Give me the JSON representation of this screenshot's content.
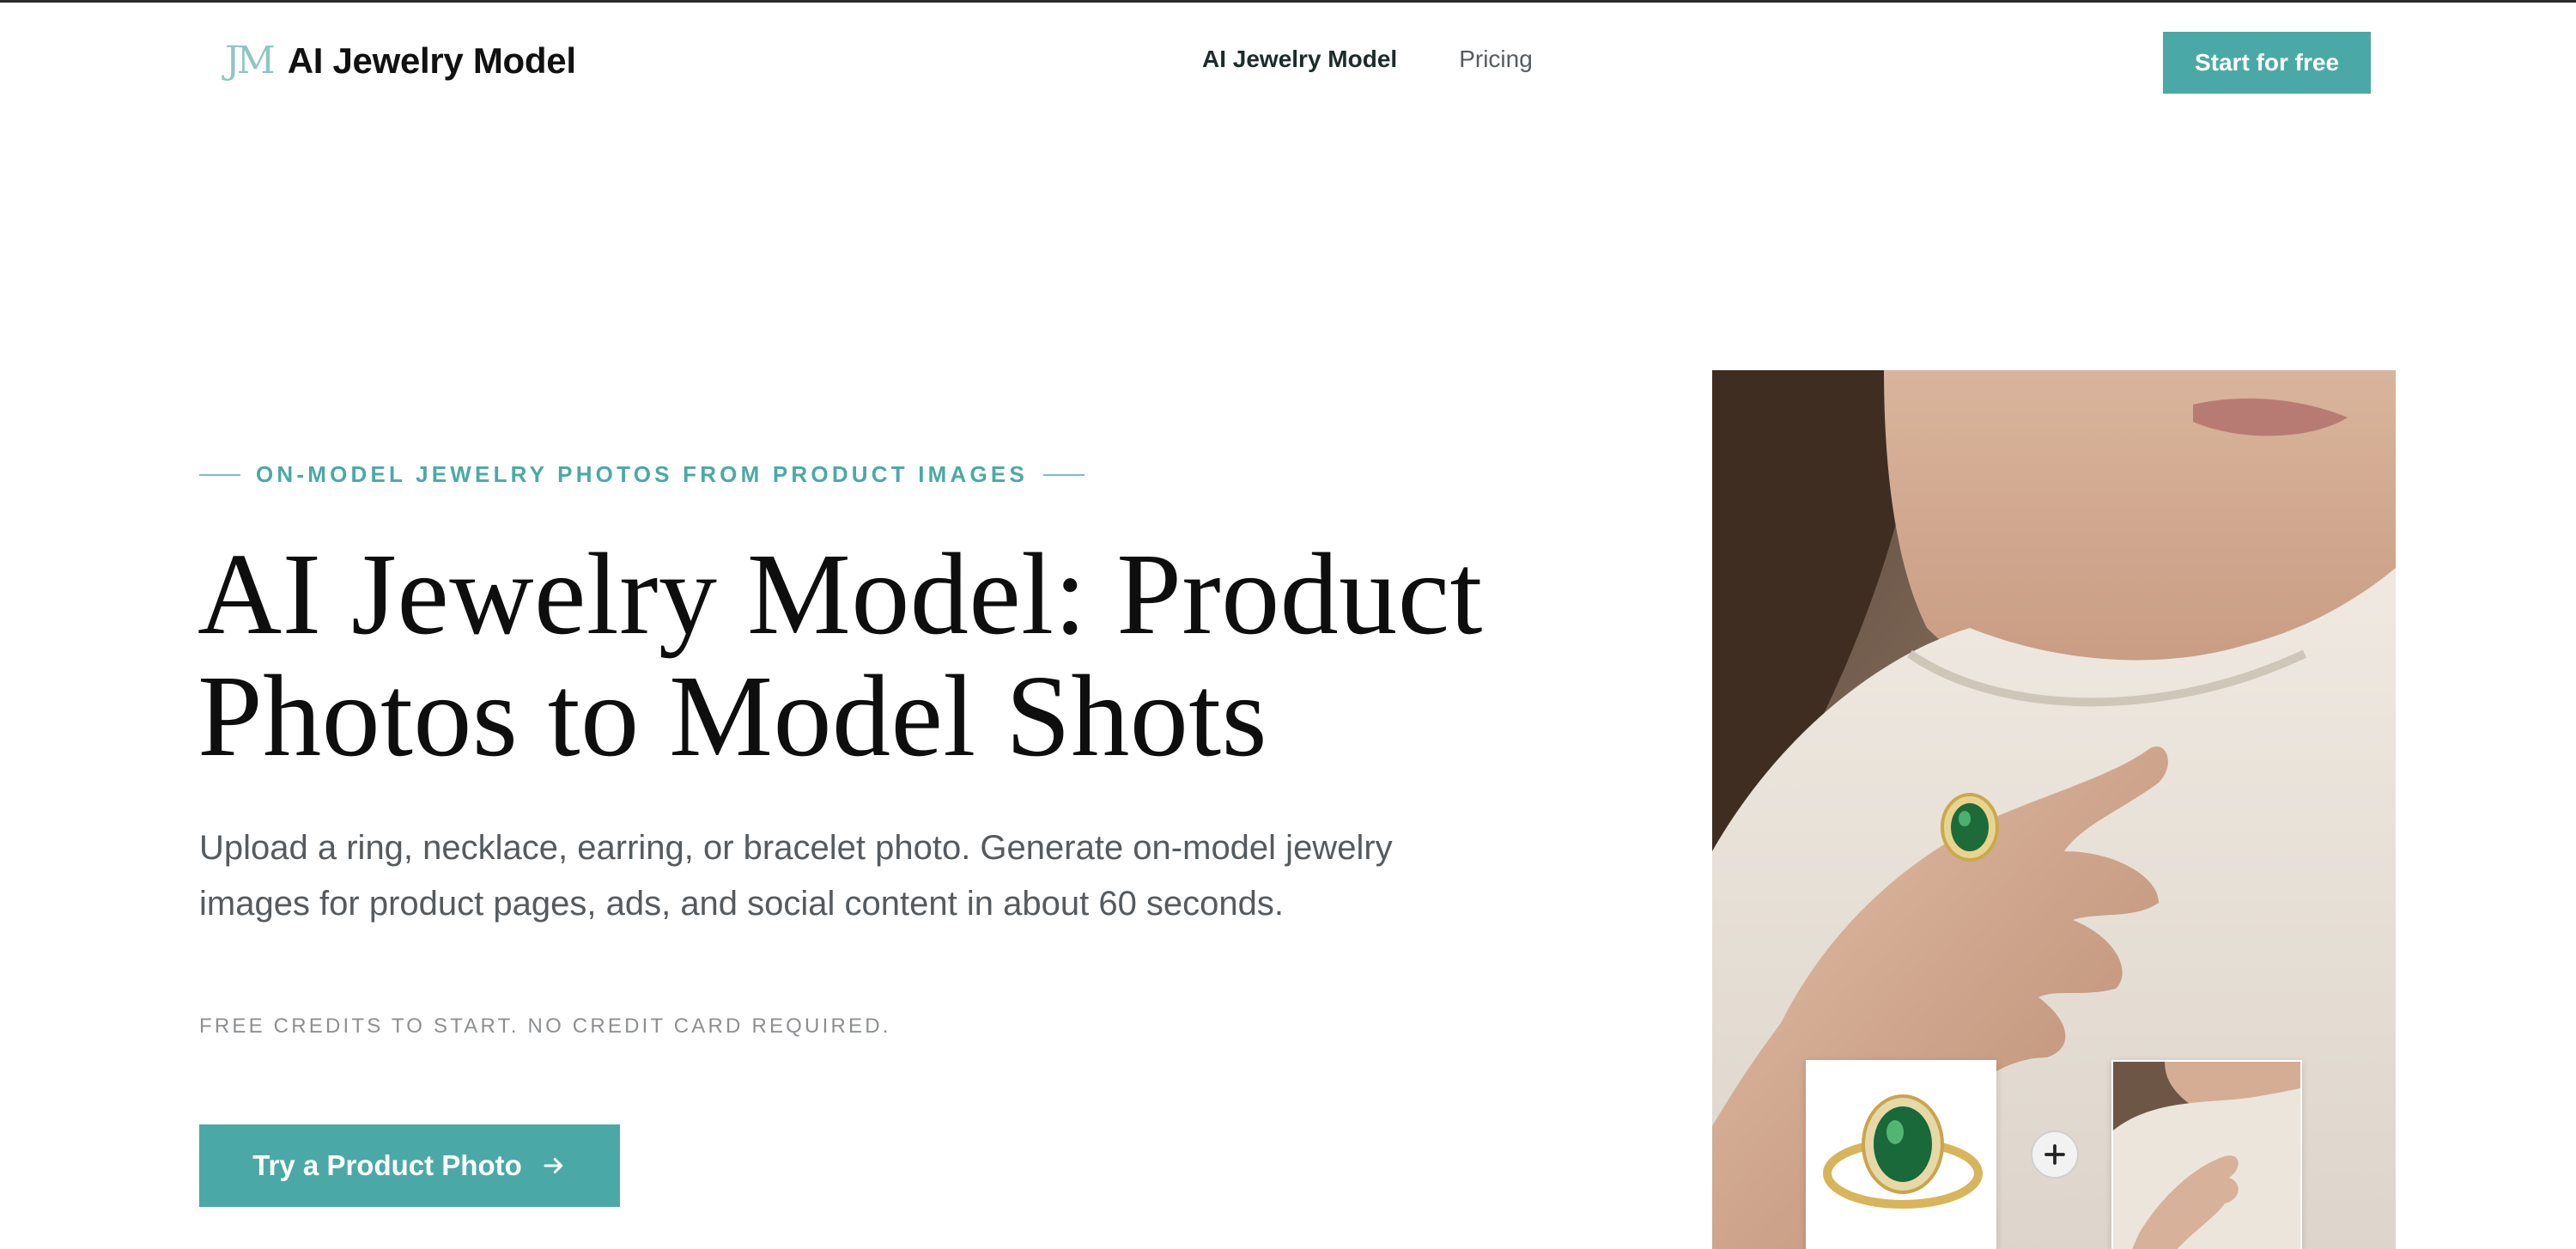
{
  "nav": {
    "brand_mark": "JM",
    "brand_name": "AI Jewelry Model",
    "links": [
      {
        "label": "AI Jewelry Model"
      },
      {
        "label": "Pricing"
      }
    ],
    "cta_label": "Start for free"
  },
  "hero": {
    "eyebrow": "ON-MODEL JEWELRY PHOTOS FROM PRODUCT IMAGES",
    "headline_line1": "AI Jewelry Model: Product",
    "headline_line2": "Photos to Model Shots",
    "lede": "Upload a ring, necklace, earring, or bracelet photo. Generate on-model jewelry images for product pages, ads, and social content in about 60 seconds.",
    "fineprint": "FREE CREDITS TO START. NO CREDIT CARD REQUIRED.",
    "cta_label": "Try a Product Photo"
  },
  "colors": {
    "accent": "#4aa9a6",
    "accent_light": "#8fc6c2",
    "text_dark": "#111111",
    "text_muted": "#555a5e"
  },
  "icons": {
    "cta_arrow": "arrow-right-icon",
    "combine": "plus-icon"
  }
}
